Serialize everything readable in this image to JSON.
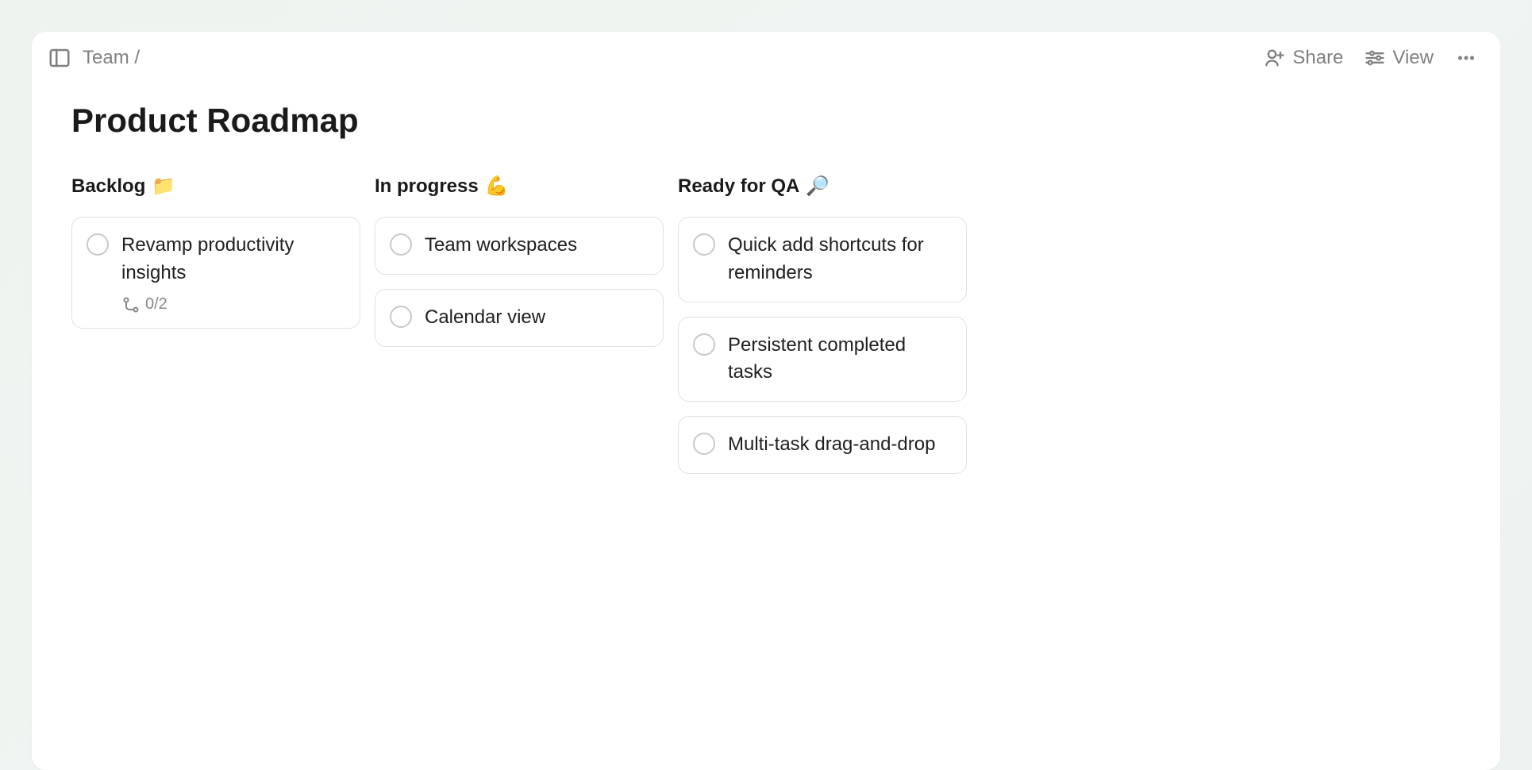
{
  "header": {
    "breadcrumb": "Team /",
    "share_label": "Share",
    "view_label": "View"
  },
  "page": {
    "title": "Product Roadmap"
  },
  "board": {
    "columns": [
      {
        "title": "Backlog",
        "emoji": "📁",
        "cards": [
          {
            "title": "Revamp productivity insights",
            "subtasks": "0/2"
          }
        ]
      },
      {
        "title": "In progress",
        "emoji": "💪",
        "cards": [
          {
            "title": "Team workspaces"
          },
          {
            "title": "Calendar view"
          }
        ]
      },
      {
        "title": "Ready for QA",
        "emoji": "🔎",
        "cards": [
          {
            "title": "Quick add shortcuts for reminders"
          },
          {
            "title": "Persistent completed tasks"
          },
          {
            "title": "Multi-task drag-and-drop"
          }
        ]
      }
    ]
  }
}
